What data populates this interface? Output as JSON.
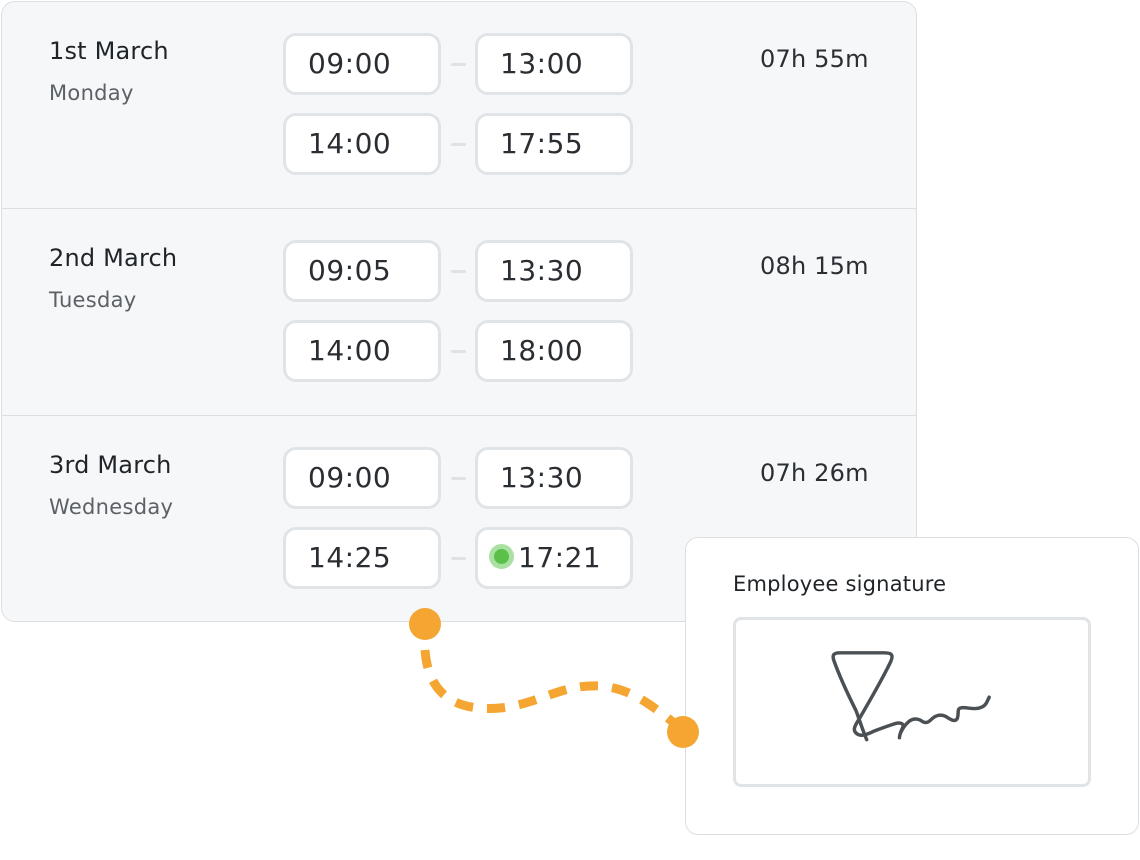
{
  "timesheet": {
    "days": [
      {
        "date": "1st March",
        "weekday": "Monday",
        "total": "07h 55m",
        "shifts": [
          {
            "start": "09:00",
            "end": "13:00"
          },
          {
            "start": "14:00",
            "end": "17:55"
          }
        ]
      },
      {
        "date": "2nd March",
        "weekday": "Tuesday",
        "total": "08h 15m",
        "shifts": [
          {
            "start": "09:05",
            "end": "13:30"
          },
          {
            "start": "14:00",
            "end": "18:00"
          }
        ]
      },
      {
        "date": "3rd March",
        "weekday": "Wednesday",
        "total": "07h 26m",
        "shifts": [
          {
            "start": "09:00",
            "end": "13:30"
          },
          {
            "start": "14:25",
            "end": "17:21",
            "live_indicator": true
          }
        ]
      }
    ],
    "separator_glyph": "–"
  },
  "signature": {
    "label": "Employee signature",
    "signed": true
  },
  "colors": {
    "accent_orange": "#f5a632",
    "live_green": "#5ac04a",
    "live_green_halo": "#a8e1a1",
    "signature_ink": "#4a5054",
    "card_background": "#f6f7f9",
    "border": "#dcdfe2"
  },
  "icons": {
    "live": "live-status-dot-icon",
    "connector": "dashed-connector-icon"
  }
}
